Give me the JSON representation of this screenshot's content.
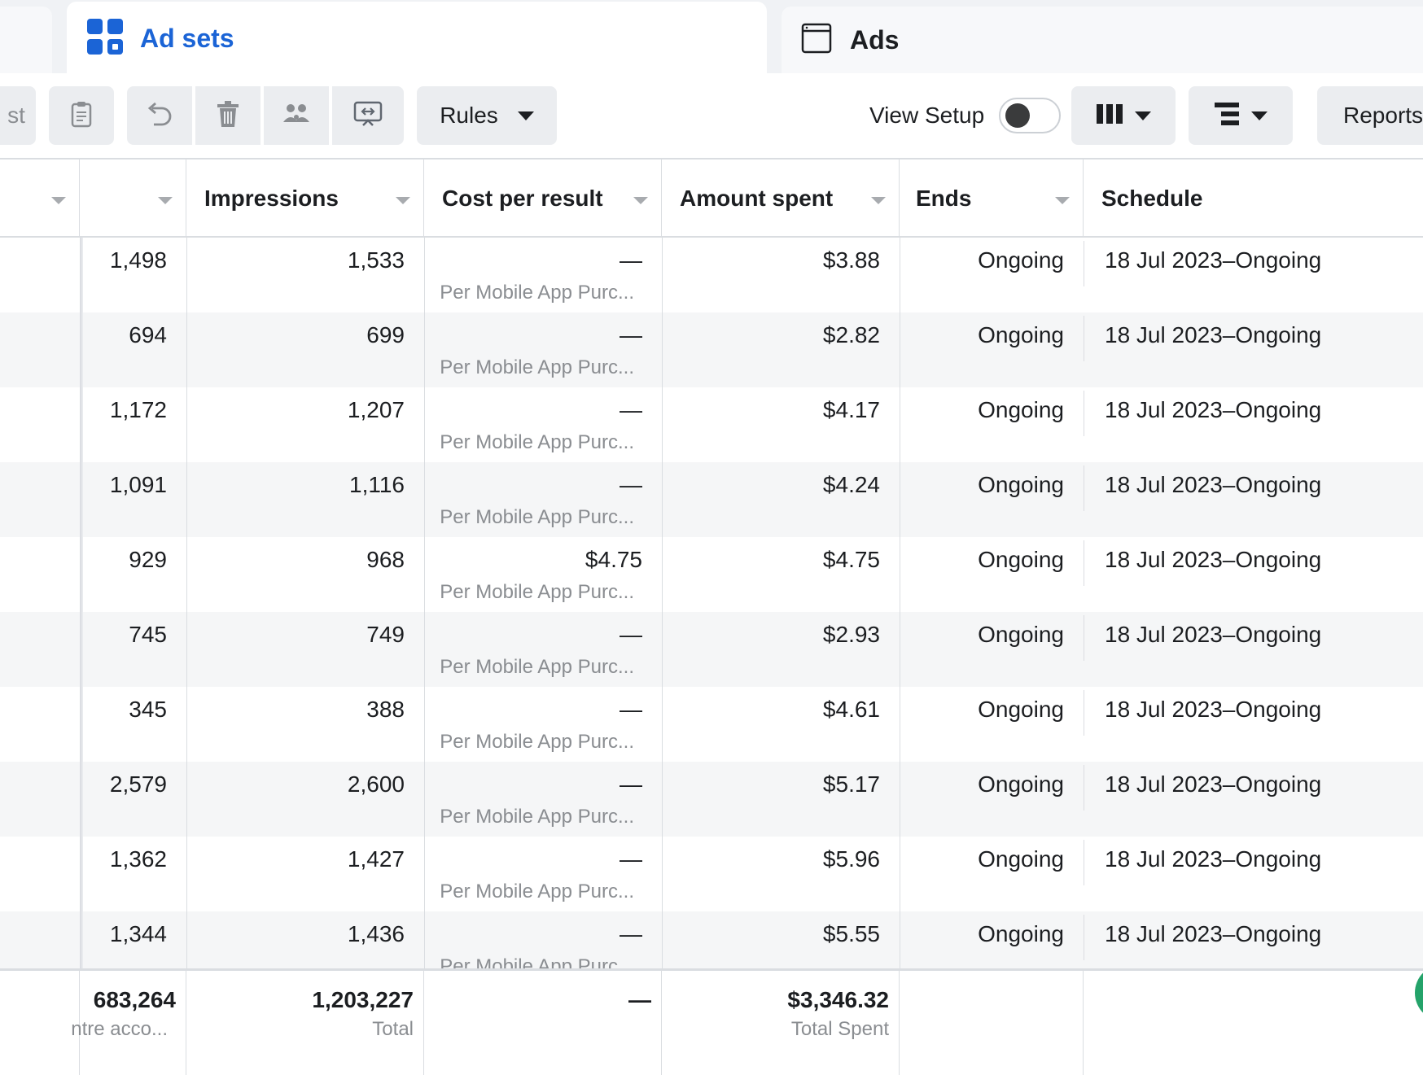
{
  "tabs": {
    "ad_sets": "Ad sets",
    "ads": "Ads"
  },
  "toolbar": {
    "partial_label": "st",
    "rules_label": "Rules",
    "view_setup_label": "View Setup",
    "view_setup_on": false,
    "reports_label": "Reports"
  },
  "columns": {
    "impressions": "Impressions",
    "cost_per_result": "Cost per result",
    "amount_spent": "Amount spent",
    "ends": "Ends",
    "schedule": "Schedule"
  },
  "rows": [
    {
      "reach": "1,498",
      "impressions": "1,533",
      "cost": "—",
      "cost_sub": "Per Mobile App Purc...",
      "spent": "$3.88",
      "ends": "Ongoing",
      "schedule": "18 Jul 2023–Ongoing"
    },
    {
      "reach": "694",
      "impressions": "699",
      "cost": "—",
      "cost_sub": "Per Mobile App Purc...",
      "spent": "$2.82",
      "ends": "Ongoing",
      "schedule": "18 Jul 2023–Ongoing"
    },
    {
      "reach": "1,172",
      "impressions": "1,207",
      "cost": "—",
      "cost_sub": "Per Mobile App Purc...",
      "spent": "$4.17",
      "ends": "Ongoing",
      "schedule": "18 Jul 2023–Ongoing"
    },
    {
      "reach": "1,091",
      "impressions": "1,116",
      "cost": "—",
      "cost_sub": "Per Mobile App Purc...",
      "spent": "$4.24",
      "ends": "Ongoing",
      "schedule": "18 Jul 2023–Ongoing"
    },
    {
      "reach": "929",
      "impressions": "968",
      "cost": "$4.75",
      "cost_sub": "Per Mobile App Purc...",
      "spent": "$4.75",
      "ends": "Ongoing",
      "schedule": "18 Jul 2023–Ongoing"
    },
    {
      "reach": "745",
      "impressions": "749",
      "cost": "—",
      "cost_sub": "Per Mobile App Purc...",
      "spent": "$2.93",
      "ends": "Ongoing",
      "schedule": "18 Jul 2023–Ongoing"
    },
    {
      "reach": "345",
      "impressions": "388",
      "cost": "—",
      "cost_sub": "Per Mobile App Purc...",
      "spent": "$4.61",
      "ends": "Ongoing",
      "schedule": "18 Jul 2023–Ongoing"
    },
    {
      "reach": "2,579",
      "impressions": "2,600",
      "cost": "—",
      "cost_sub": "Per Mobile App Purc...",
      "spent": "$5.17",
      "ends": "Ongoing",
      "schedule": "18 Jul 2023–Ongoing"
    },
    {
      "reach": "1,362",
      "impressions": "1,427",
      "cost": "—",
      "cost_sub": "Per Mobile App Purc...",
      "spent": "$5.96",
      "ends": "Ongoing",
      "schedule": "18 Jul 2023–Ongoing"
    },
    {
      "reach": "1,344",
      "impressions": "1,436",
      "cost": "—",
      "cost_sub": "Per Mobile App Purc...",
      "spent": "$5.55",
      "ends": "Ongoing",
      "schedule": "18 Jul 2023–Ongoing"
    }
  ],
  "totals": {
    "reach": "683,264",
    "reach_sub": "ntre acco...",
    "impressions": "1,203,227",
    "impressions_sub": "Total",
    "cost": "—",
    "spent": "$3,346.32",
    "spent_sub": "Total Spent"
  },
  "icons": {
    "ad_sets_tab": "grid-squares-icon",
    "ads_tab": "window-icon",
    "toolbar": [
      "clipboard-icon",
      "undo-icon",
      "trash-icon",
      "people-icon",
      "preview-icon",
      "columns-icon",
      "breakdown-icon"
    ]
  },
  "colors": {
    "accent": "#1b64d6",
    "row_alt": "#f5f6f7",
    "muted_text": "#8a8d91",
    "button_bg": "#ebedf0",
    "bubble": "#24a36a"
  }
}
